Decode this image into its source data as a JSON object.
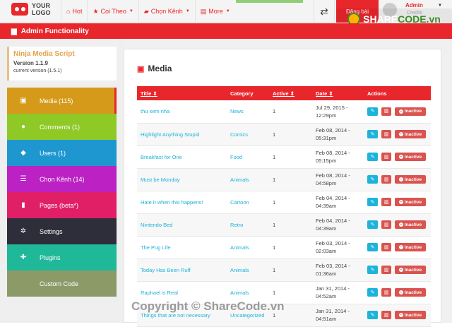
{
  "logo": {
    "line1": "YOUR",
    "line2": "LOGO"
  },
  "nav": [
    {
      "icon": "home-icon",
      "glyph": "⌂",
      "label": "Hot",
      "caret": false
    },
    {
      "icon": "star-icon",
      "glyph": "★",
      "label": "Coi Theo",
      "caret": true
    },
    {
      "icon": "folder-icon",
      "glyph": "▰",
      "label": "Chọn Kênh",
      "caret": true
    },
    {
      "icon": "file-icon",
      "glyph": "▤",
      "label": "More",
      "caret": true
    }
  ],
  "top_right": {
    "post_label": "Đăng bài",
    "user_name": "Admin",
    "user_sub": "Credits"
  },
  "admin_bar": {
    "title": "Admin Functionality"
  },
  "info": {
    "name": "Ninja Media Script",
    "version": "Version 1.1.9",
    "current": "current version (1.5.1)"
  },
  "menu": [
    {
      "label": "Media (115)",
      "icon": "image-icon",
      "glyph": "▣",
      "color": "#d59a1a",
      "active": true
    },
    {
      "label": "Comments (1)",
      "icon": "comments-icon",
      "glyph": "●",
      "color": "#8ec926",
      "active": false
    },
    {
      "label": "Users (1)",
      "icon": "user-icon",
      "glyph": "◆",
      "color": "#1e97d1",
      "active": false
    },
    {
      "label": "Chọn Kênh (14)",
      "icon": "list-icon",
      "glyph": "☰",
      "color": "#bc21c4",
      "active": false
    },
    {
      "label": "Pages (beta*)",
      "icon": "file-icon",
      "glyph": "▮",
      "color": "#e01f66",
      "active": false
    },
    {
      "label": "Settings",
      "icon": "gear-icon",
      "glyph": "✲",
      "color": "#2e2e3a",
      "active": false
    },
    {
      "label": "Plugins",
      "icon": "puzzle-icon",
      "glyph": "✚",
      "color": "#1fb899",
      "active": false
    },
    {
      "label": "Custom Code",
      "icon": "code-icon",
      "glyph": "</>",
      "color": "#8c9a68",
      "active": false
    }
  ],
  "media": {
    "title": "Media",
    "columns": {
      "title": "Title",
      "category": "Category",
      "active": "Active",
      "date": "Date",
      "actions": "Actions"
    },
    "inactive_label": "Inactive",
    "rows": [
      {
        "title": "thu xem nha",
        "category": "News",
        "active": "1",
        "date1": "Jul 29, 2015 -",
        "date2": "12:29pm"
      },
      {
        "title": "Highlight Anything Stupid",
        "category": "Comics",
        "active": "1",
        "date1": "Feb 08, 2014 -",
        "date2": "05:31pm"
      },
      {
        "title": "Breakfast for One",
        "category": "Food",
        "active": "1",
        "date1": "Feb 08, 2014 -",
        "date2": "05:15pm"
      },
      {
        "title": "Must be Monday",
        "category": "Animals",
        "active": "1",
        "date1": "Feb 08, 2014 -",
        "date2": "04:58pm"
      },
      {
        "title": "Hate it when this happens!",
        "category": "Cartoon",
        "active": "1",
        "date1": "Feb 04, 2014 -",
        "date2": "04:39am"
      },
      {
        "title": "Nintendo Bed",
        "category": "Retro",
        "active": "1",
        "date1": "Feb 04, 2014 -",
        "date2": "04:39am"
      },
      {
        "title": "The Pug Life",
        "category": "Animals",
        "active": "1",
        "date1": "Feb 03, 2014 -",
        "date2": "02:03am"
      },
      {
        "title": "Today Has Been Ruff",
        "category": "Animals",
        "active": "1",
        "date1": "Feb 03, 2014 -",
        "date2": "01:36am"
      },
      {
        "title": "Raphael is Real",
        "category": "Animals",
        "active": "1",
        "date1": "Jan 31, 2014 -",
        "date2": "04:52am"
      },
      {
        "title": "Things that are not necessary",
        "category": "Uncategorized",
        "active": "1",
        "date1": "Jan 31, 2014 -",
        "date2": "04:51am"
      }
    ]
  },
  "watermark": {
    "logo_a": "SHARE",
    "logo_b": "CODE.vn",
    "bottom": "Copyright © ShareCode.vn"
  }
}
